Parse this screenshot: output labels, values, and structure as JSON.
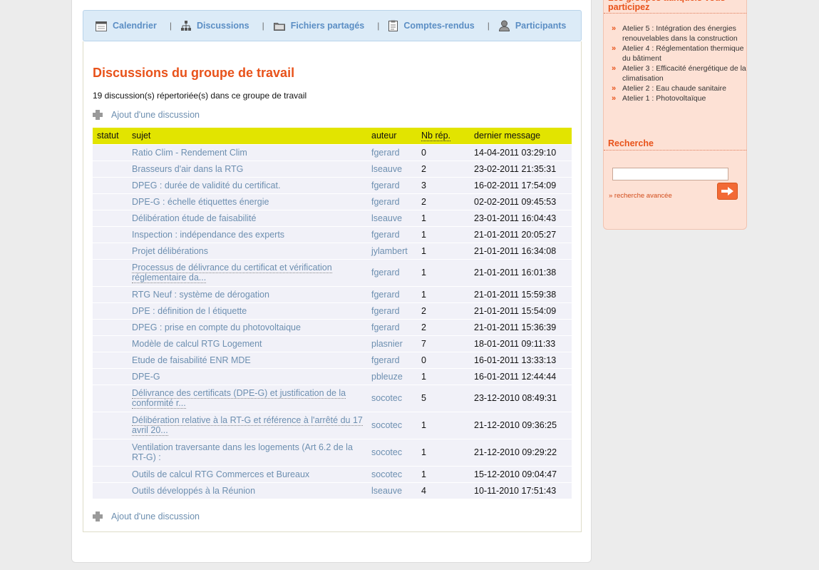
{
  "nav": {
    "items": [
      {
        "label": "Calendrier",
        "icon": "calendar-icon"
      },
      {
        "label": "Discussions",
        "icon": "sitemap-icon"
      },
      {
        "label": "Fichiers partagés",
        "icon": "folder-icon"
      },
      {
        "label": "Comptes-rendus",
        "icon": "clipboard-icon"
      },
      {
        "label": "Participants",
        "icon": "user-icon"
      }
    ],
    "separator": "|"
  },
  "main": {
    "title": "Discussions du groupe de travail",
    "count_text": "19 discussion(s) répertoriée(s) dans ce groupe de travail",
    "add_label": "Ajout d'une discussion",
    "columns": [
      "statut",
      "sujet",
      "auteur",
      "Nb rép.",
      "dernier message"
    ],
    "rows": [
      {
        "subject": "Ratio Clim - Rendement Clim",
        "author": "fgerard",
        "replies": "0",
        "last": "14-04-2011 03:29:10"
      },
      {
        "subject": "Brasseurs d'air dans la RTG",
        "author": "lseauve",
        "replies": "2",
        "last": "23-02-2011 21:35:31"
      },
      {
        "subject": "DPEG : durée de validité du certificat.",
        "author": "fgerard",
        "replies": "3",
        "last": "16-02-2011 17:54:09"
      },
      {
        "subject": "DPE-G : échelle étiquettes énergie",
        "author": "fgerard",
        "replies": "2",
        "last": "02-02-2011 09:45:53"
      },
      {
        "subject": "Délibération étude de faisabilité",
        "author": "lseauve",
        "replies": "1",
        "last": "23-01-2011 16:04:43"
      },
      {
        "subject": "Inspection : indépendance des experts",
        "author": "fgerard",
        "replies": "1",
        "last": "21-01-2011 20:05:27"
      },
      {
        "subject": "Projet délibérations",
        "author": "jylambert",
        "replies": "1",
        "last": "21-01-2011 16:34:08"
      },
      {
        "subject": "Processus de délivrance du certificat et vérification réglementaire da...",
        "author": "fgerard",
        "replies": "1",
        "last": "21-01-2011 16:01:38",
        "two_line": true
      },
      {
        "subject": "RTG Neuf : système de dérogation",
        "author": "fgerard",
        "replies": "1",
        "last": "21-01-2011 15:59:38"
      },
      {
        "subject": "DPE : définition de l étiquette",
        "author": "fgerard",
        "replies": "2",
        "last": "21-01-2011 15:54:09"
      },
      {
        "subject": "DPEG : prise en compte du photovoltaique",
        "author": "fgerard",
        "replies": "2",
        "last": "21-01-2011 15:36:39"
      },
      {
        "subject": "Modèle de calcul RTG Logement",
        "author": "plasnier",
        "replies": "7",
        "last": "18-01-2011 09:11:33"
      },
      {
        "subject": "Etude de faisabilité ENR MDE",
        "author": "fgerard",
        "replies": "0",
        "last": "16-01-2011 13:33:13"
      },
      {
        "subject": "DPE-G",
        "author": "pbleuze",
        "replies": "1",
        "last": "16-01-2011 12:44:44"
      },
      {
        "subject": "Délivrance des certificats (DPE-G) et justification de la conformité r...",
        "author": "socotec",
        "replies": "5",
        "last": "23-12-2010 08:49:31",
        "two_line": true
      },
      {
        "subject": "Délibération relative à la RT-G et référence à l'arrêté du 17 avril 20...",
        "author": "socotec",
        "replies": "1",
        "last": "21-12-2010 09:36:25",
        "two_line": true
      },
      {
        "subject": "Ventilation traversante dans les logements (Art 6.2 de la RT-G) :",
        "author": "socotec",
        "replies": "1",
        "last": "21-12-2010 09:29:22",
        "two_line": true,
        "plain": true
      },
      {
        "subject": "Outils de calcul RTG Commerces et Bureaux",
        "author": "socotec",
        "replies": "1",
        "last": "15-12-2010 09:04:47"
      },
      {
        "subject": "Outils développés à la Réunion",
        "author": "lseauve",
        "replies": "4",
        "last": "10-11-2010 17:51:43"
      }
    ]
  },
  "sidebar": {
    "groups_heading": "Les groupes auxquels vous participez",
    "groups": [
      "Atelier 5 : Intégration des énergies renouvelables dans la construction",
      "Atelier 4 : Réglementation thermique du bâtiment",
      "Atelier 3 : Efficacité énergétique de la climatisation",
      "Atelier 2 : Eau chaude sanitaire",
      "Atelier 1 : Photovoltaïque"
    ],
    "search_heading": "Recherche",
    "search_value": "",
    "advanced_link": "» recherche avancée"
  },
  "colors": {
    "accent": "#e8521a",
    "link": "#6d8fb0",
    "nav_bg": "#dcebf7",
    "table_header": "#e2e400",
    "sidebar_bg": "#fde1d5"
  }
}
